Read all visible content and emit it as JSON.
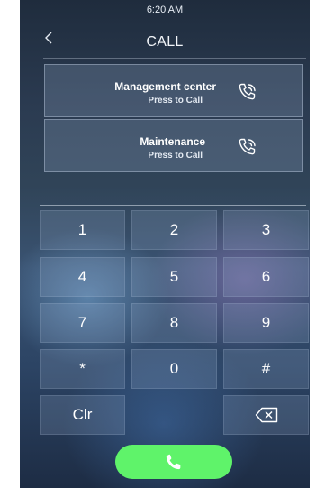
{
  "status_bar": {
    "time": "6:20 AM"
  },
  "header": {
    "title": "CALL",
    "back_icon": "chevron-left-icon"
  },
  "contacts": [
    {
      "name": "Management center",
      "subtitle": "Press to Call",
      "icon": "phone-call-icon"
    },
    {
      "name": "Maintenance",
      "subtitle": "Press to Call",
      "icon": "phone-call-icon"
    }
  ],
  "keypad": {
    "rows": [
      [
        "1",
        "2",
        "3"
      ],
      [
        "4",
        "5",
        "6"
      ],
      [
        "7",
        "8",
        "9"
      ],
      [
        "*",
        "0",
        "#"
      ]
    ],
    "clear_label": "Clr",
    "backspace_icon": "backspace-icon"
  },
  "call_button": {
    "icon": "phone-icon",
    "color": "#5ff36a"
  }
}
